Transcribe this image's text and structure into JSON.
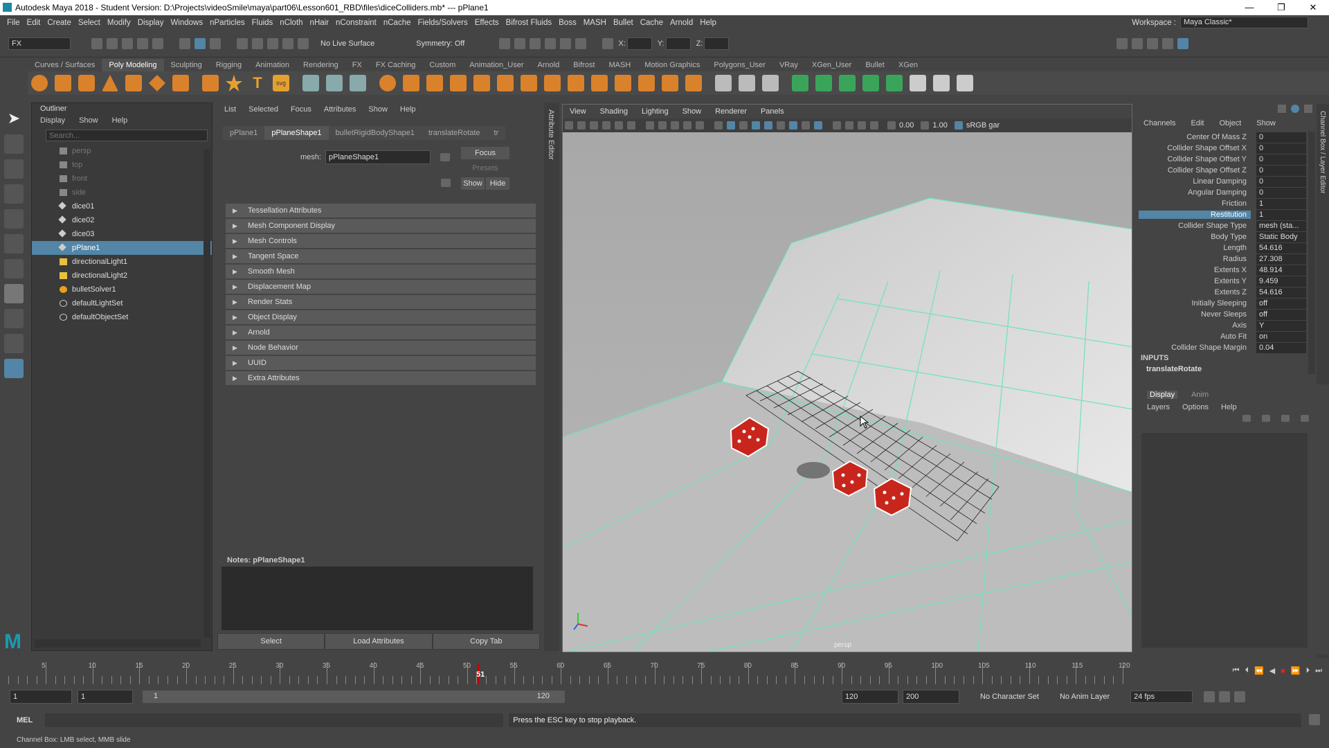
{
  "titlebar": {
    "title": "Autodesk Maya 2018 - Student Version: D:\\Projects\\videoSmile\\maya\\part06\\Lesson601_RBD\\files\\diceColliders.mb*  ---  pPlane1",
    "min": "—",
    "max": "❐",
    "close": "✕"
  },
  "menu": [
    "File",
    "Edit",
    "Create",
    "Select",
    "Modify",
    "Display",
    "Windows",
    "nParticles",
    "Fluids",
    "nCloth",
    "nHair",
    "nConstraint",
    "nCache",
    "Fields/Solvers",
    "Effects",
    "Bifrost Fluids",
    "Boss",
    "MASH",
    "Bullet",
    "Cache",
    "Arnold",
    "Help"
  ],
  "workspace": {
    "label": "Workspace :",
    "value": "Maya Classic*"
  },
  "statusline": {
    "menuset": "FX",
    "live_surface": "No Live Surface",
    "symmetry": "Symmetry: Off",
    "x_label": "X:",
    "y_label": "Y:",
    "z_label": "Z:"
  },
  "shelf_tabs": [
    "Curves / Surfaces",
    "Poly Modeling",
    "Sculpting",
    "Rigging",
    "Animation",
    "Rendering",
    "FX",
    "FX Caching",
    "Custom",
    "Animation_User",
    "Arnold",
    "Bifrost",
    "MASH",
    "Motion Graphics",
    "Polygons_User",
    "VRay",
    "XGen_User",
    "Bullet",
    "XGen"
  ],
  "shelf_active": "Poly Modeling",
  "outliner": {
    "title": "Outliner",
    "menu": [
      "Display",
      "Show",
      "Help"
    ],
    "search_placeholder": "Search...",
    "items": [
      {
        "label": "persp",
        "dim": true,
        "icon": "camera-icon"
      },
      {
        "label": "top",
        "dim": true,
        "icon": "camera-icon"
      },
      {
        "label": "front",
        "dim": true,
        "icon": "camera-icon"
      },
      {
        "label": "side",
        "dim": true,
        "icon": "camera-icon"
      },
      {
        "label": "dice01",
        "icon": "mesh-icon"
      },
      {
        "label": "dice02",
        "icon": "mesh-icon"
      },
      {
        "label": "dice03",
        "icon": "mesh-icon"
      },
      {
        "label": "pPlane1",
        "selected": true,
        "icon": "mesh-icon"
      },
      {
        "label": "directionalLight1",
        "icon": "light-icon"
      },
      {
        "label": "directionalLight2",
        "icon": "light-icon"
      },
      {
        "label": "bulletSolver1",
        "icon": "solver-icon"
      },
      {
        "label": "defaultLightSet",
        "icon": "set-icon"
      },
      {
        "label": "defaultObjectSet",
        "icon": "set-icon"
      }
    ]
  },
  "attr_editor": {
    "menu": [
      "List",
      "Selected",
      "Focus",
      "Attributes",
      "Show",
      "Help"
    ],
    "tabs": [
      "pPlane1",
      "pPlaneShape1",
      "bulletRigidBodyShape1",
      "translateRotate",
      "tr"
    ],
    "active_tab": "pPlaneShape1",
    "mesh_label": "mesh:",
    "mesh_value": "pPlaneShape1",
    "focus": "Focus",
    "presets": "Presets",
    "show": "Show",
    "hide": "Hide",
    "sections": [
      "Tessellation Attributes",
      "Mesh Component Display",
      "Mesh Controls",
      "Tangent Space",
      "Smooth Mesh",
      "Displacement Map",
      "Render Stats",
      "Object Display",
      "Arnold",
      "Node Behavior",
      "UUID",
      "Extra Attributes"
    ],
    "notes": "Notes:  pPlaneShape1",
    "buttons": [
      "Select",
      "Load Attributes",
      "Copy Tab"
    ],
    "side_label": "Attribute Editor"
  },
  "viewport": {
    "menu": [
      "View",
      "Shading",
      "Lighting",
      "Show",
      "Renderer",
      "Panels"
    ],
    "field1": "0.00",
    "field2": "1.00",
    "colorspace": "sRGB gar",
    "camera_label": "persp"
  },
  "channels": {
    "menu": [
      "Channels",
      "Edit",
      "Object",
      "Show"
    ],
    "rows": [
      {
        "n": "Center Of Mass Z",
        "v": "0"
      },
      {
        "n": "Collider Shape Offset X",
        "v": "0"
      },
      {
        "n": "Collider Shape Offset Y",
        "v": "0"
      },
      {
        "n": "Collider Shape Offset Z",
        "v": "0"
      },
      {
        "n": "Linear Damping",
        "v": "0"
      },
      {
        "n": "Angular Damping",
        "v": "0"
      },
      {
        "n": "Friction",
        "v": "1"
      },
      {
        "n": "Restitution",
        "v": "1",
        "hl": true
      },
      {
        "n": "Collider Shape Type",
        "v": "mesh (sta..."
      },
      {
        "n": "Body Type",
        "v": "Static Body"
      },
      {
        "n": "Length",
        "v": "54.616"
      },
      {
        "n": "Radius",
        "v": "27.308"
      },
      {
        "n": "Extents X",
        "v": "48.914"
      },
      {
        "n": "Extents Y",
        "v": "9.459"
      },
      {
        "n": "Extents Z",
        "v": "54.616"
      },
      {
        "n": "Initially Sleeping",
        "v": "off"
      },
      {
        "n": "Never Sleeps",
        "v": "off"
      },
      {
        "n": "Axis",
        "v": "Y"
      },
      {
        "n": "Auto Fit",
        "v": "on"
      },
      {
        "n": "Collider Shape Margin",
        "v": "0.04"
      }
    ],
    "inputs_label": "INPUTS",
    "inputs_node": "translateRotate",
    "side_label": "Channel Box / Layer Editor"
  },
  "layers": {
    "tabs": [
      "Display",
      "Anim"
    ],
    "menu": [
      "Layers",
      "Options",
      "Help"
    ]
  },
  "timeline": {
    "ticks": [
      "5",
      "10",
      "15",
      "20",
      "25",
      "30",
      "35",
      "40",
      "45",
      "50",
      "55",
      "60",
      "65",
      "70",
      "75",
      "80",
      "85",
      "90",
      "95",
      "100",
      "105",
      "110",
      "115",
      "120"
    ],
    "current": "51"
  },
  "range": {
    "start": "1",
    "start2": "1",
    "slider_start": "1",
    "slider_end": "120",
    "end": "120",
    "end2": "200",
    "char_set": "No Character Set",
    "anim_layer": "No Anim Layer",
    "fps": "24 fps"
  },
  "cmd": {
    "label": "MEL",
    "result": "Press the ESC key to stop playback."
  },
  "help": "Channel Box: LMB select, MMB slide"
}
